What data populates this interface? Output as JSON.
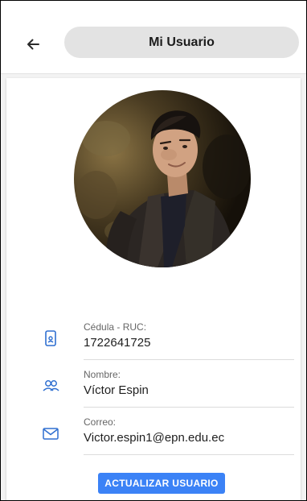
{
  "header": {
    "title": "Mi Usuario",
    "back_icon": "arrow-left-icon"
  },
  "profile": {
    "photo": "user-portrait-photo"
  },
  "fields": [
    {
      "icon": "phone-id-icon",
      "label": "Cédula - RUC:",
      "value": "1722641725"
    },
    {
      "icon": "users-icon",
      "label": "Nombre:",
      "value": "Víctor Espin"
    },
    {
      "icon": "mail-icon",
      "label": "Correo:",
      "value": "Victor.espin1@epn.edu.ec"
    }
  ],
  "actions": {
    "update_label": "ACTUALIZAR USUARIO"
  },
  "colors": {
    "accent": "#3b82f6",
    "icon": "#2f6fd0",
    "title_pill": "#e3e3e3"
  }
}
